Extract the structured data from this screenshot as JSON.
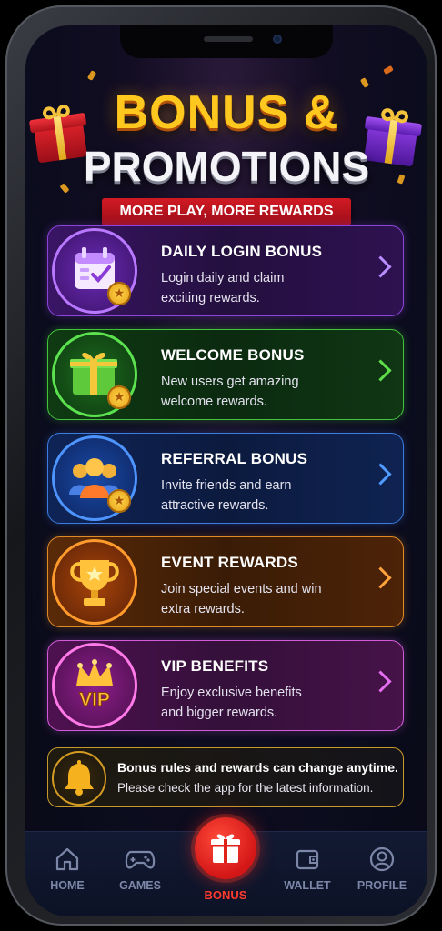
{
  "header": {
    "title_line1": "BONUS &",
    "title_line2": "PROMOTIONS",
    "ribbon": "MORE PLAY, MORE REWARDS"
  },
  "cards": [
    {
      "title": "DAILY LOGIN BONUS",
      "desc": "Login daily and claim exciting rewards.",
      "icon": "calendar-check-icon",
      "accent": "#8b45d8"
    },
    {
      "title": "WELCOME BONUS",
      "desc": "New users get amazing welcome rewards.",
      "icon": "gift-icon",
      "accent": "#43c43a"
    },
    {
      "title": "REFERRAL BONUS",
      "desc": "Invite friends and earn attractive rewards.",
      "icon": "people-icon",
      "accent": "#3d7ce0"
    },
    {
      "title": "EVENT REWARDS",
      "desc": "Join special events and win extra rewards.",
      "icon": "trophy-icon",
      "accent": "#e08a26"
    },
    {
      "title": "VIP BENEFITS",
      "desc": "Enjoy exclusive benefits and bigger rewards.",
      "icon": "crown-icon",
      "accent": "#d25cd8",
      "badge_text": "VIP"
    }
  ],
  "notice": {
    "line1": "Bonus rules and rewards can change anytime.",
    "line2": "Please check the app for the latest information.",
    "icon": "bell-icon"
  },
  "nav": {
    "items": [
      {
        "label": "HOME",
        "icon": "home-icon"
      },
      {
        "label": "GAMES",
        "icon": "gamepad-icon"
      },
      {
        "label": "BONUS",
        "icon": "gift-icon",
        "active": true
      },
      {
        "label": "WALLET",
        "icon": "wallet-icon"
      },
      {
        "label": "PROFILE",
        "icon": "profile-icon"
      }
    ],
    "active_color": "#ff3a2e"
  }
}
